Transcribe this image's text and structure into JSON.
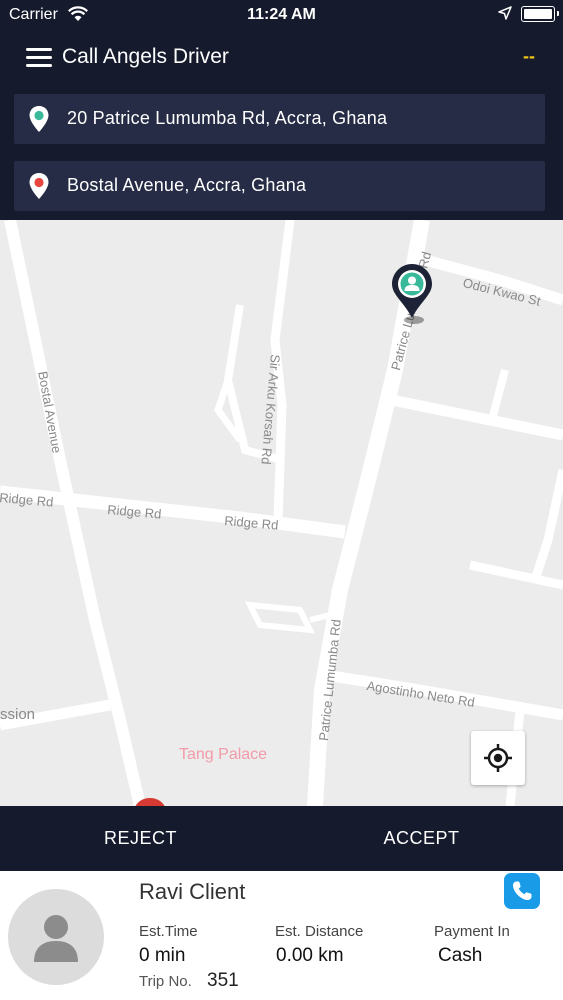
{
  "status_bar": {
    "carrier": "Carrier",
    "time": "11:24 AM"
  },
  "header": {
    "title": "Call Angels Driver",
    "status": "--"
  },
  "pickup": {
    "address": "20 Patrice Lumumba Rd, Accra, Ghana",
    "pin_color": "#3ab89a"
  },
  "dropoff": {
    "address": "Bostal Avenue, Accra, Ghana",
    "pin_color": "#e8473f"
  },
  "map": {
    "labels": {
      "odoi_kwao": "Odoi Kwao St",
      "sir_arku_korsah": "Sir Arku Korsah Rd",
      "bostal_avenue": "Bostal Avenue",
      "ridge_rd_1": "Ridge Rd",
      "ridge_rd_2": "Ridge Rd",
      "ridge_rd_3": "Ridge Rd",
      "patrice_top": "Patrice Lumumba Rd",
      "patrice_bottom": "Patrice Lumumba Rd",
      "agostinho": "Agostinho Neto Rd",
      "mission": "ssion"
    },
    "poi": "Tang Palace"
  },
  "actions": {
    "reject": "REJECT",
    "accept": "ACCEPT"
  },
  "trip": {
    "client_name": "Ravi Client",
    "est_time_label": "Est.Time",
    "est_time_value": "0 min",
    "est_distance_label": "Est. Distance",
    "est_distance_value": "0.00 km",
    "payment_label": "Payment In",
    "payment_value": "Cash",
    "trip_no_label": "Trip No.",
    "trip_no_value": "351"
  },
  "colors": {
    "header_bg": "#151a2d",
    "field_bg": "#262c45",
    "accent_blue": "#1a9be8",
    "status_yellow": "#f0c419"
  }
}
